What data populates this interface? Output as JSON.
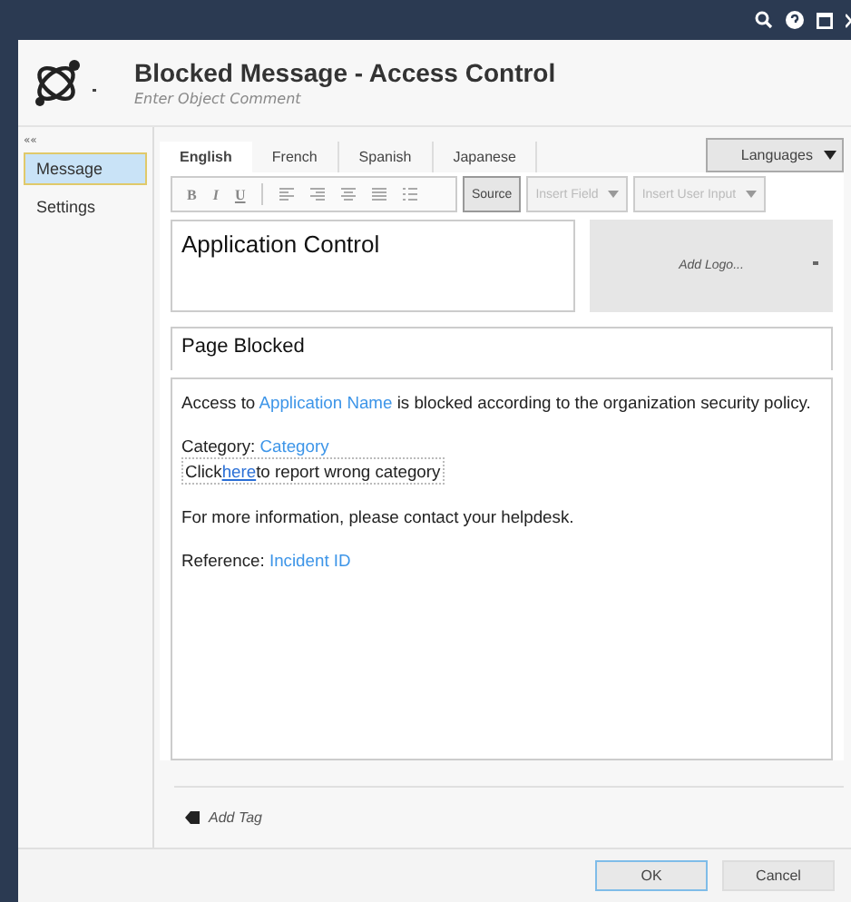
{
  "header": {
    "title": "Blocked Message - Access Control",
    "comment_placeholder": "Enter Object Comment"
  },
  "sidebar": {
    "collapse": "««",
    "items": [
      {
        "label": "Message",
        "selected": true
      },
      {
        "label": "Settings",
        "selected": false
      }
    ]
  },
  "tabs": [
    {
      "label": "English",
      "selected": true
    },
    {
      "label": "French",
      "selected": false
    },
    {
      "label": "Spanish",
      "selected": false
    },
    {
      "label": "Japanese",
      "selected": false
    }
  ],
  "languages_button": "Languages",
  "toolbar": {
    "format": [
      "B",
      "I",
      "U"
    ],
    "buttons": [
      {
        "label": "Source",
        "disabled": false,
        "dropdown": false
      },
      {
        "label": "Insert Field",
        "disabled": true,
        "dropdown": true
      },
      {
        "label": "Insert User Input",
        "disabled": true,
        "dropdown": true
      }
    ]
  },
  "title_field": "Application Control",
  "logo_button": "Add Logo...",
  "heading_field": "Page Blocked",
  "body": [
    [
      {
        "kind": "plain",
        "segments": [
          {
            "kind": "text",
            "text": "Access to "
          },
          {
            "kind": "field",
            "text": "Application Name"
          },
          {
            "kind": "text",
            "text": " is blocked according to the organization security policy."
          }
        ]
      }
    ],
    [
      {
        "kind": "plain",
        "segments": [
          {
            "kind": "text",
            "text": "Category: "
          },
          {
            "kind": "field",
            "text": "Category"
          }
        ]
      },
      {
        "kind": "boxed",
        "segments": [
          {
            "kind": "text",
            "text": "Click"
          },
          {
            "kind": "link",
            "text": "here"
          },
          {
            "kind": "text",
            "text": "to report wrong category"
          }
        ]
      }
    ],
    [
      {
        "kind": "plain",
        "segments": [
          {
            "kind": "text",
            "text": "For more information, please contact your helpdesk."
          }
        ]
      }
    ],
    [
      {
        "kind": "plain",
        "segments": [
          {
            "kind": "text",
            "text": "Reference: "
          },
          {
            "kind": "field",
            "text": "Incident ID"
          }
        ]
      }
    ]
  ],
  "add_tag": "Add Tag",
  "footer": [
    {
      "label": "OK",
      "selected": true
    },
    {
      "label": "Cancel",
      "selected": false
    }
  ]
}
